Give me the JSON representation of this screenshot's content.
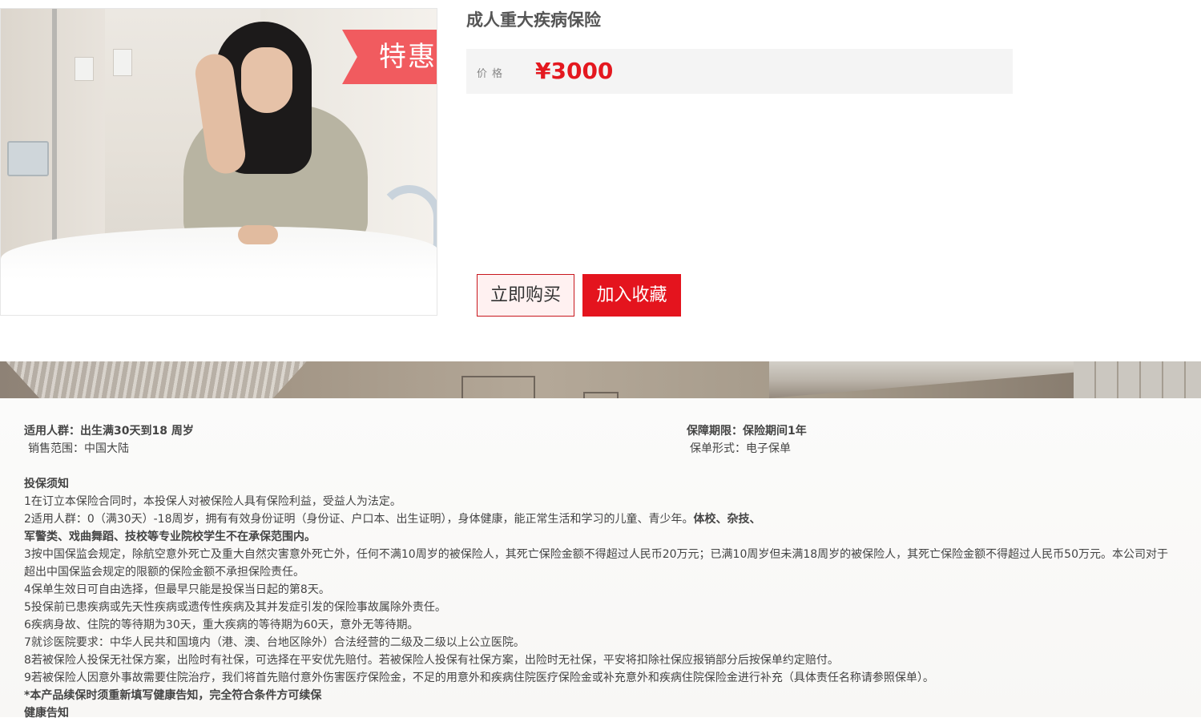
{
  "product": {
    "title": "成人重大疾病保险",
    "image_promo_text": "特惠",
    "price_label": "价格",
    "price": "¥3000",
    "buy_label": "立即购买",
    "favorite_label": "加入收藏"
  },
  "details": {
    "audience_label": "适用人群：",
    "audience_value": "出生满30天到18 周岁",
    "region_text": "销售范围：中国大陆",
    "term_label": "保障期限：",
    "term_value": "保险期间1年",
    "form_text": "保单形式：电子保单"
  },
  "notice": {
    "title": "投保须知",
    "item1": "1在订立本保险合同时，本投保人对被保险人具有保险利益，受益人为法定。",
    "item2_normal": "2适用人群：0（满30天）-18周岁，拥有有效身份证明（身份证、户口本、出生证明），身体健康，能正常生活和学习的儿童、青少年。",
    "item2_bold_a": "体校、杂技、",
    "item2_bold_b": "军警类、戏曲舞蹈、技校等专业院校学生不在承保范围内。",
    "item3": "3按中国保监会规定，除航空意外死亡及重大自然灾害意外死亡外，任何不满10周岁的被保险人，其死亡保险金额不得超过人民币20万元；已满10周岁但未满18周岁的被保险人，其死亡保险金额不得超过人民币50万元。本公司对于超出中国保监会规定的限额的保险金额不承担保险责任。",
    "item4": "4保单生效日可自由选择，但最早只能是投保当日起的第8天。",
    "item5": "5投保前已患疾病或先天性疾病或遗传性疾病及其并发症引发的保险事故属除外责任。",
    "item6": "6疾病身故、住院的等待期为30天，重大疾病的等待期为60天，意外无等待期。",
    "item7": "7就诊医院要求：中华人民共和国境内（港、澳、台地区除外）合法经营的二级及二级以上公立医院。",
    "item8": "8若被保险人投保无社保方案，出险时有社保，可选择在平安优先赔付。若被保险人投保有社保方案，出险时无社保，平安将扣除社保应报销部分后按保单约定赔付。",
    "item9": "9若被保险人因意外事故需要住院治疗，我们将首先赔付意外伤害医疗保险金，不足的用意外和疾病住院医疗保险金或补充意外和疾病住院保险金进行补充（具体责任名称请参照保单）。",
    "renewal_note": "*本产品续保时须重新填写健康告知，完全符合条件方可续保",
    "health_title": "健康告知"
  }
}
